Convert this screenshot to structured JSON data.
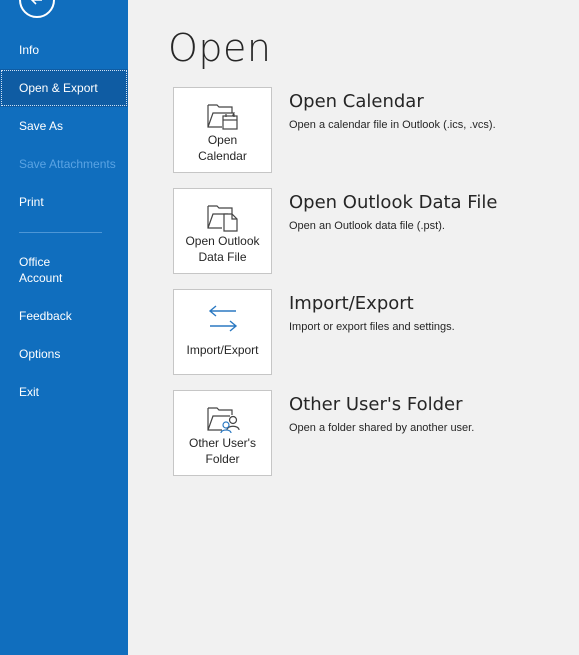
{
  "sidebar": {
    "back_icon": "back-arrow-icon",
    "items": [
      {
        "label": "Info"
      },
      {
        "label": "Open & Export"
      },
      {
        "label": "Save As"
      },
      {
        "label": "Save Attachments"
      },
      {
        "label": "Print"
      },
      {
        "label": "Office\nAccount"
      },
      {
        "label": "Feedback"
      },
      {
        "label": "Options"
      },
      {
        "label": "Exit"
      }
    ]
  },
  "main": {
    "title": "Open",
    "options": [
      {
        "tile_label": "Open\nCalendar",
        "icon": "folder-calendar-icon",
        "title": "Open Calendar",
        "description": "Open a calendar file in Outlook (.ics, .vcs)."
      },
      {
        "tile_label": "Open Outlook\nData File",
        "icon": "folder-document-icon",
        "title": "Open Outlook Data File",
        "description": "Open an Outlook data file (.pst)."
      },
      {
        "tile_label": "Import/Export",
        "icon": "import-export-arrows-icon",
        "title": "Import/Export",
        "description": "Import or export files and settings."
      },
      {
        "tile_label": "Other User's\nFolder",
        "icon": "shared-folder-user-icon",
        "title": "Other User's Folder",
        "description": "Open a folder shared by another user."
      }
    ]
  },
  "colors": {
    "sidebar_bg": "#106ebe",
    "sidebar_selected": "#0f5ca3",
    "accent_blue": "#2b79c2",
    "page_bg": "#f1f1f1"
  }
}
